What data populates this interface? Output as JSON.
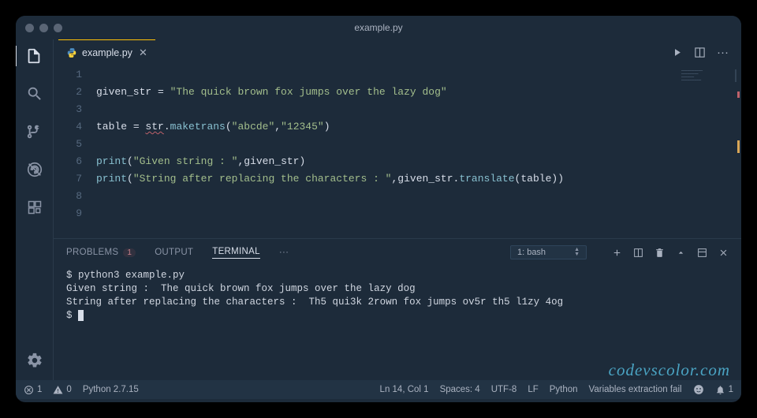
{
  "window": {
    "title": "example.py"
  },
  "tab": {
    "filename": "example.py"
  },
  "editor": {
    "lines": [
      "1",
      "2",
      "3",
      "4",
      "5",
      "6",
      "7",
      "8",
      "9"
    ],
    "code": {
      "l2_var": "given_str",
      "l2_eq": " = ",
      "l2_str": "\"The quick brown fox jumps over the lazy dog\"",
      "l4_var": "table",
      "l4_eq": " = ",
      "l4_obj": "str",
      "l4_dot": ".",
      "l4_meth": "maketrans",
      "l4_op": "(",
      "l4_s1": "\"abcde\"",
      "l4_c": ",",
      "l4_s2": "\"12345\"",
      "l4_cl": ")",
      "l6_fn": "print",
      "l6_op": "(",
      "l6_s": "\"Given string : \"",
      "l6_c": ",",
      "l6_v": "given_str",
      "l6_cl": ")",
      "l7_fn": "print",
      "l7_op": "(",
      "l7_s": "\"String after replacing the characters : \"",
      "l7_c": ",",
      "l7_v": "given_str",
      "l7_dot": ".",
      "l7_meth": "translate",
      "l7_op2": "(",
      "l7_arg": "table",
      "l7_cl2": ")",
      "l7_cl": ")"
    }
  },
  "panel": {
    "tabs": {
      "problems": "PROBLEMS",
      "problems_badge": "1",
      "output": "OUTPUT",
      "terminal": "TERMINAL",
      "more": "···"
    },
    "term_select": "1: bash",
    "terminal_lines": {
      "l1": "$ python3 example.py",
      "l2": "Given string :  The quick brown fox jumps over the lazy dog",
      "l3": "String after replacing the characters :  Th5 qui3k 2rown fox jumps ov5r th5 l1zy 4og",
      "l4_prompt": "$ "
    }
  },
  "status": {
    "errors": "1",
    "warnings": "0",
    "python": "Python 2.7.15",
    "pos": "Ln 14, Col 1",
    "spaces": "Spaces: 4",
    "encoding": "UTF-8",
    "eol": "LF",
    "lang": "Python",
    "extra": "Variables extraction fail",
    "notif": "1"
  },
  "watermark": "codevscolor.com"
}
